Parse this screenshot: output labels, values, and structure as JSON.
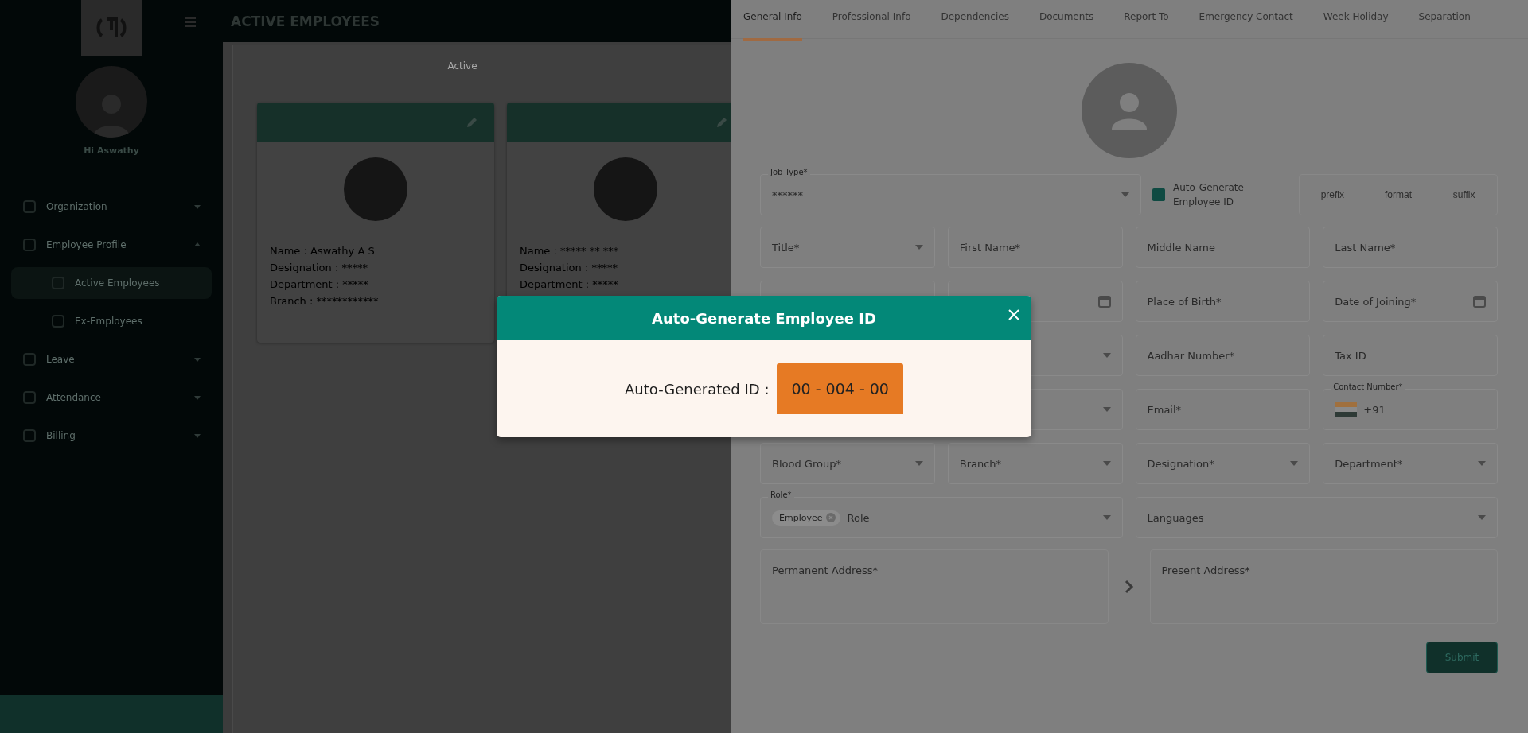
{
  "sidebar": {
    "user_name": "Hi Aswathy",
    "menu": [
      {
        "label": "Organization",
        "expanded": false,
        "selected": false
      },
      {
        "label": "Employee Profile",
        "expanded": true,
        "selected": false,
        "children": [
          {
            "label": "Active Employees",
            "selected": true
          },
          {
            "label": "Ex-Employees",
            "selected": false
          }
        ]
      },
      {
        "label": "Leave",
        "expanded": false,
        "selected": false
      },
      {
        "label": "Attendance",
        "expanded": false,
        "selected": false
      },
      {
        "label": "Billing",
        "expanded": false,
        "selected": false
      }
    ]
  },
  "header": {
    "title": "ACTIVE EMPLOYEES"
  },
  "main_tabs": [
    {
      "label": "Active",
      "selected": true
    }
  ],
  "employee_cards": [
    {
      "fields": [
        "Name : Aswathy A S",
        "Designation : *****",
        "Department : *****",
        "Branch : ************"
      ]
    },
    {
      "fields": [
        "Name : ***** ** ***",
        "Designation : *****",
        "Department : *****"
      ]
    }
  ],
  "drawer": {
    "tabs": [
      {
        "label": "General Info",
        "selected": true
      },
      {
        "label": "Professional Info",
        "selected": false
      },
      {
        "label": "Dependencies",
        "selected": false
      },
      {
        "label": "Documents",
        "selected": false
      },
      {
        "label": "Report To",
        "selected": false
      },
      {
        "label": "Emergency Contact",
        "selected": false
      },
      {
        "label": "Week Holiday",
        "selected": false
      },
      {
        "label": "Separation",
        "selected": false
      }
    ],
    "job_type": {
      "label": "Job Type*",
      "value": "******"
    },
    "auto_generate": {
      "label": "Auto-Generate Employee ID",
      "checked": true
    },
    "id_parts": [
      {
        "placeholder": "prefix"
      },
      {
        "placeholder": "format"
      },
      {
        "placeholder": "suffix"
      }
    ],
    "field_rows": [
      [
        {
          "kind": "select",
          "label": "Title*"
        },
        {
          "kind": "text",
          "label": "First Name*"
        },
        {
          "kind": "text",
          "label": "Middle Name"
        },
        {
          "kind": "text",
          "label": "Last Name*"
        }
      ],
      [
        {
          "kind": "text"
        },
        {
          "kind": "date"
        },
        {
          "kind": "text",
          "label": "Place of Birth*"
        },
        {
          "kind": "date",
          "label": "Date of Joining*"
        }
      ],
      [
        {
          "kind": "select"
        },
        {
          "kind": "text",
          "label": "Aadhar Number*"
        },
        {
          "kind": "text",
          "label": "Tax ID"
        }
      ],
      [
        {
          "kind": "select"
        },
        {
          "kind": "text",
          "label": "Email*"
        },
        {
          "kind": "phone",
          "label": "Contact Number*",
          "value": "+91"
        }
      ],
      [
        {
          "kind": "select",
          "label": "Blood Group*"
        },
        {
          "kind": "select",
          "label": "Branch*"
        },
        {
          "kind": "select",
          "label": "Designation*"
        },
        {
          "kind": "select",
          "label": "Department*"
        }
      ],
      [
        {
          "kind": "multiselect",
          "label": "Role*",
          "chip": "Employee",
          "placeholder": "Role"
        },
        {
          "kind": "multiselect",
          "label": "Languages"
        }
      ]
    ],
    "addresses": [
      {
        "label": "Permanent Address*"
      },
      {
        "label": "Present Address*"
      }
    ],
    "submit": "Submit"
  },
  "dialog": {
    "title": "Auto-Generate Employee ID",
    "label": "Auto-Generated ID :",
    "value": "00 - 004 - 00"
  }
}
